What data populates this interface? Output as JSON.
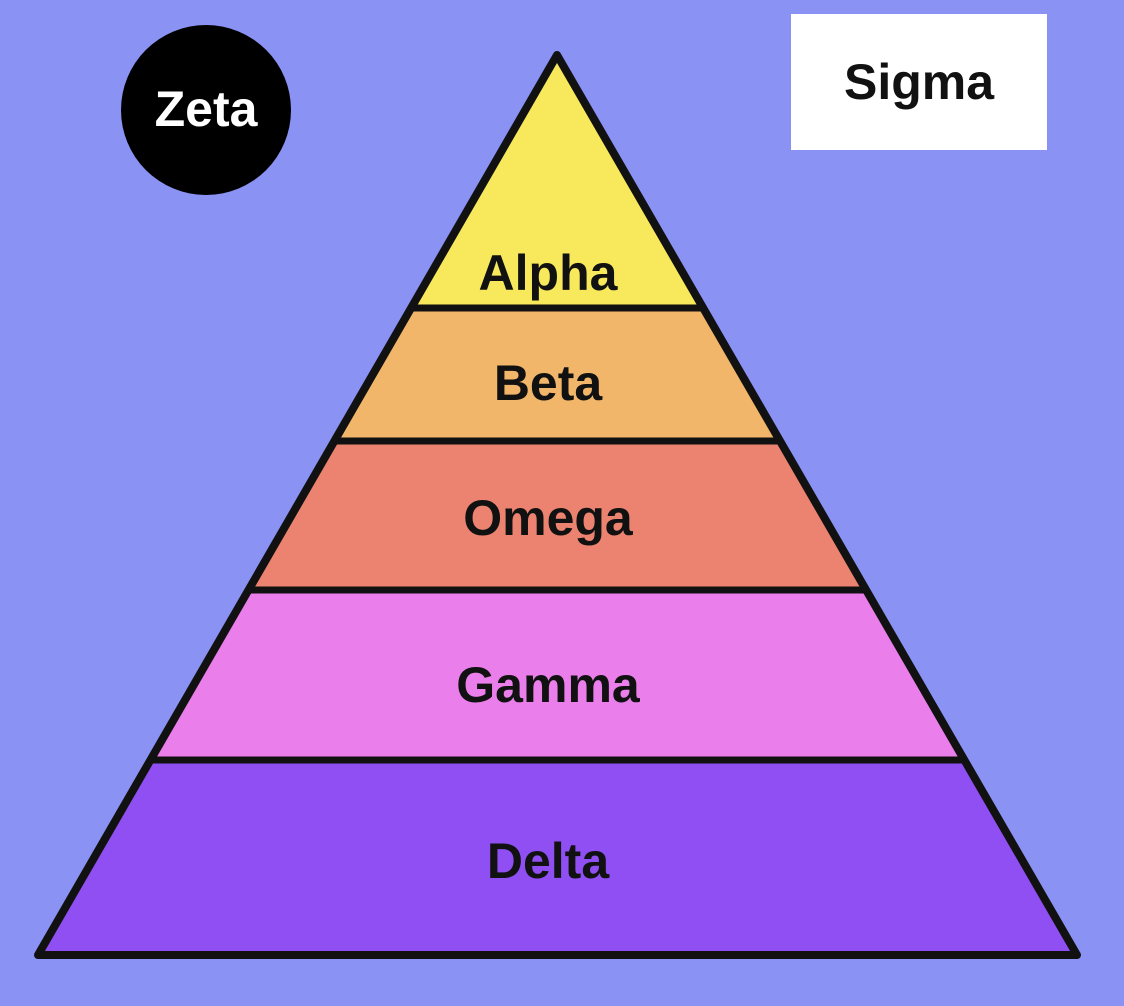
{
  "colors": {
    "background": "#8a92f4",
    "outline": "#111111",
    "text": "#111111"
  },
  "pyramid": {
    "levels": [
      {
        "label": "Alpha",
        "color": "#f7e85c"
      },
      {
        "label": "Beta",
        "color": "#f1b669"
      },
      {
        "label": "Omega",
        "color": "#ec8370"
      },
      {
        "label": "Gamma",
        "color": "#ea7eea"
      },
      {
        "label": "Delta",
        "color": "#8f4ff3"
      }
    ]
  },
  "circle_badge": {
    "label": "Zeta",
    "fill": "#000000",
    "text_color": "#ffffff"
  },
  "box_badge": {
    "label": "Sigma",
    "fill": "#ffffff",
    "text_color": "#111111"
  }
}
